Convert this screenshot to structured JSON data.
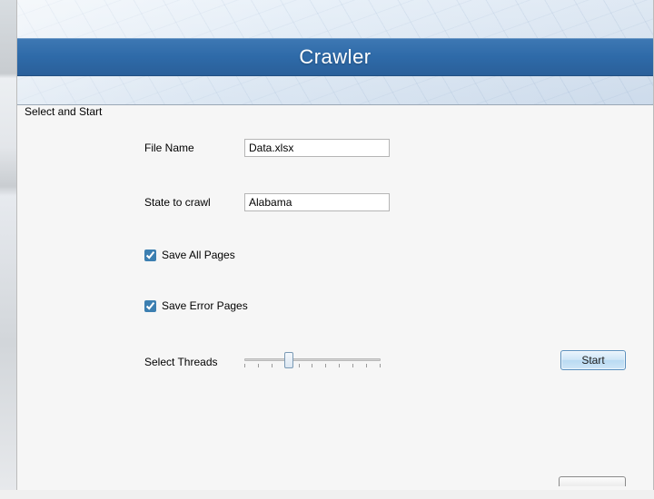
{
  "banner": {
    "title": "Crawler"
  },
  "group": {
    "title": "Select and Start"
  },
  "fields": {
    "file_name": {
      "label": "File Name",
      "value": "Data.xlsx"
    },
    "state": {
      "label": "State to crawl",
      "value": "Alabama"
    },
    "save_all_pages": {
      "label": "Save All Pages",
      "checked": true
    },
    "save_error_pages": {
      "label": "Save Error Pages",
      "checked": true
    },
    "threads": {
      "label": "Select Threads",
      "min": 1,
      "max": 11,
      "value": 4
    }
  },
  "buttons": {
    "start": "Start"
  }
}
